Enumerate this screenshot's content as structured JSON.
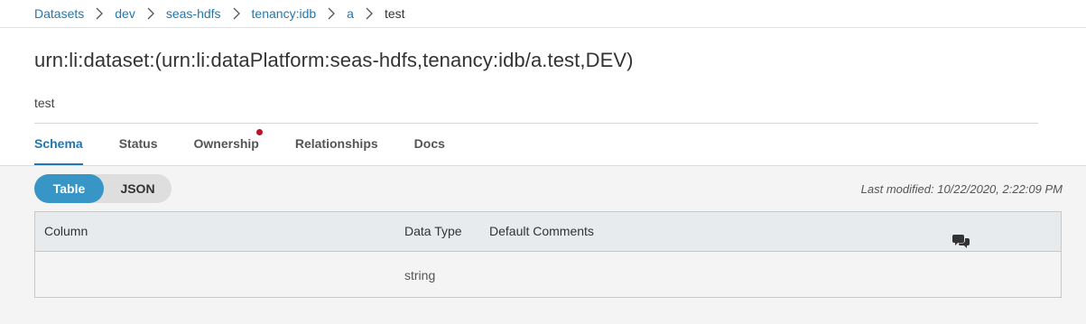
{
  "breadcrumb": {
    "items": [
      "Datasets",
      "dev",
      "seas-hdfs",
      "tenancy:idb",
      "a",
      "test"
    ]
  },
  "dataset": {
    "urn": "urn:li:dataset:(urn:li:dataPlatform:seas-hdfs,tenancy:idb/a.test,DEV)",
    "description": "test"
  },
  "tabs": [
    {
      "label": "Schema",
      "active": true
    },
    {
      "label": "Status"
    },
    {
      "label": "Ownership",
      "notification": true
    },
    {
      "label": "Relationships"
    },
    {
      "label": "Docs"
    }
  ],
  "schema": {
    "view_toggle": {
      "table_label": "Table",
      "json_label": "JSON",
      "selected": "Table"
    },
    "last_modified": "Last modified: 10/22/2020, 2:22:09 PM",
    "table": {
      "headers": {
        "column": "Column",
        "data_type": "Data Type",
        "default_comments": "Default Comments",
        "comments_icon": "comments-icon"
      },
      "rows": [
        {
          "column": "",
          "data_type": "string",
          "default_comments": ""
        }
      ]
    }
  },
  "colors": {
    "link": "#1f78b4",
    "accent": "#3796c5",
    "notification_dot": "#c0112b",
    "content_background": "#f4f4f4",
    "table_header_background": "#e7ebee"
  }
}
